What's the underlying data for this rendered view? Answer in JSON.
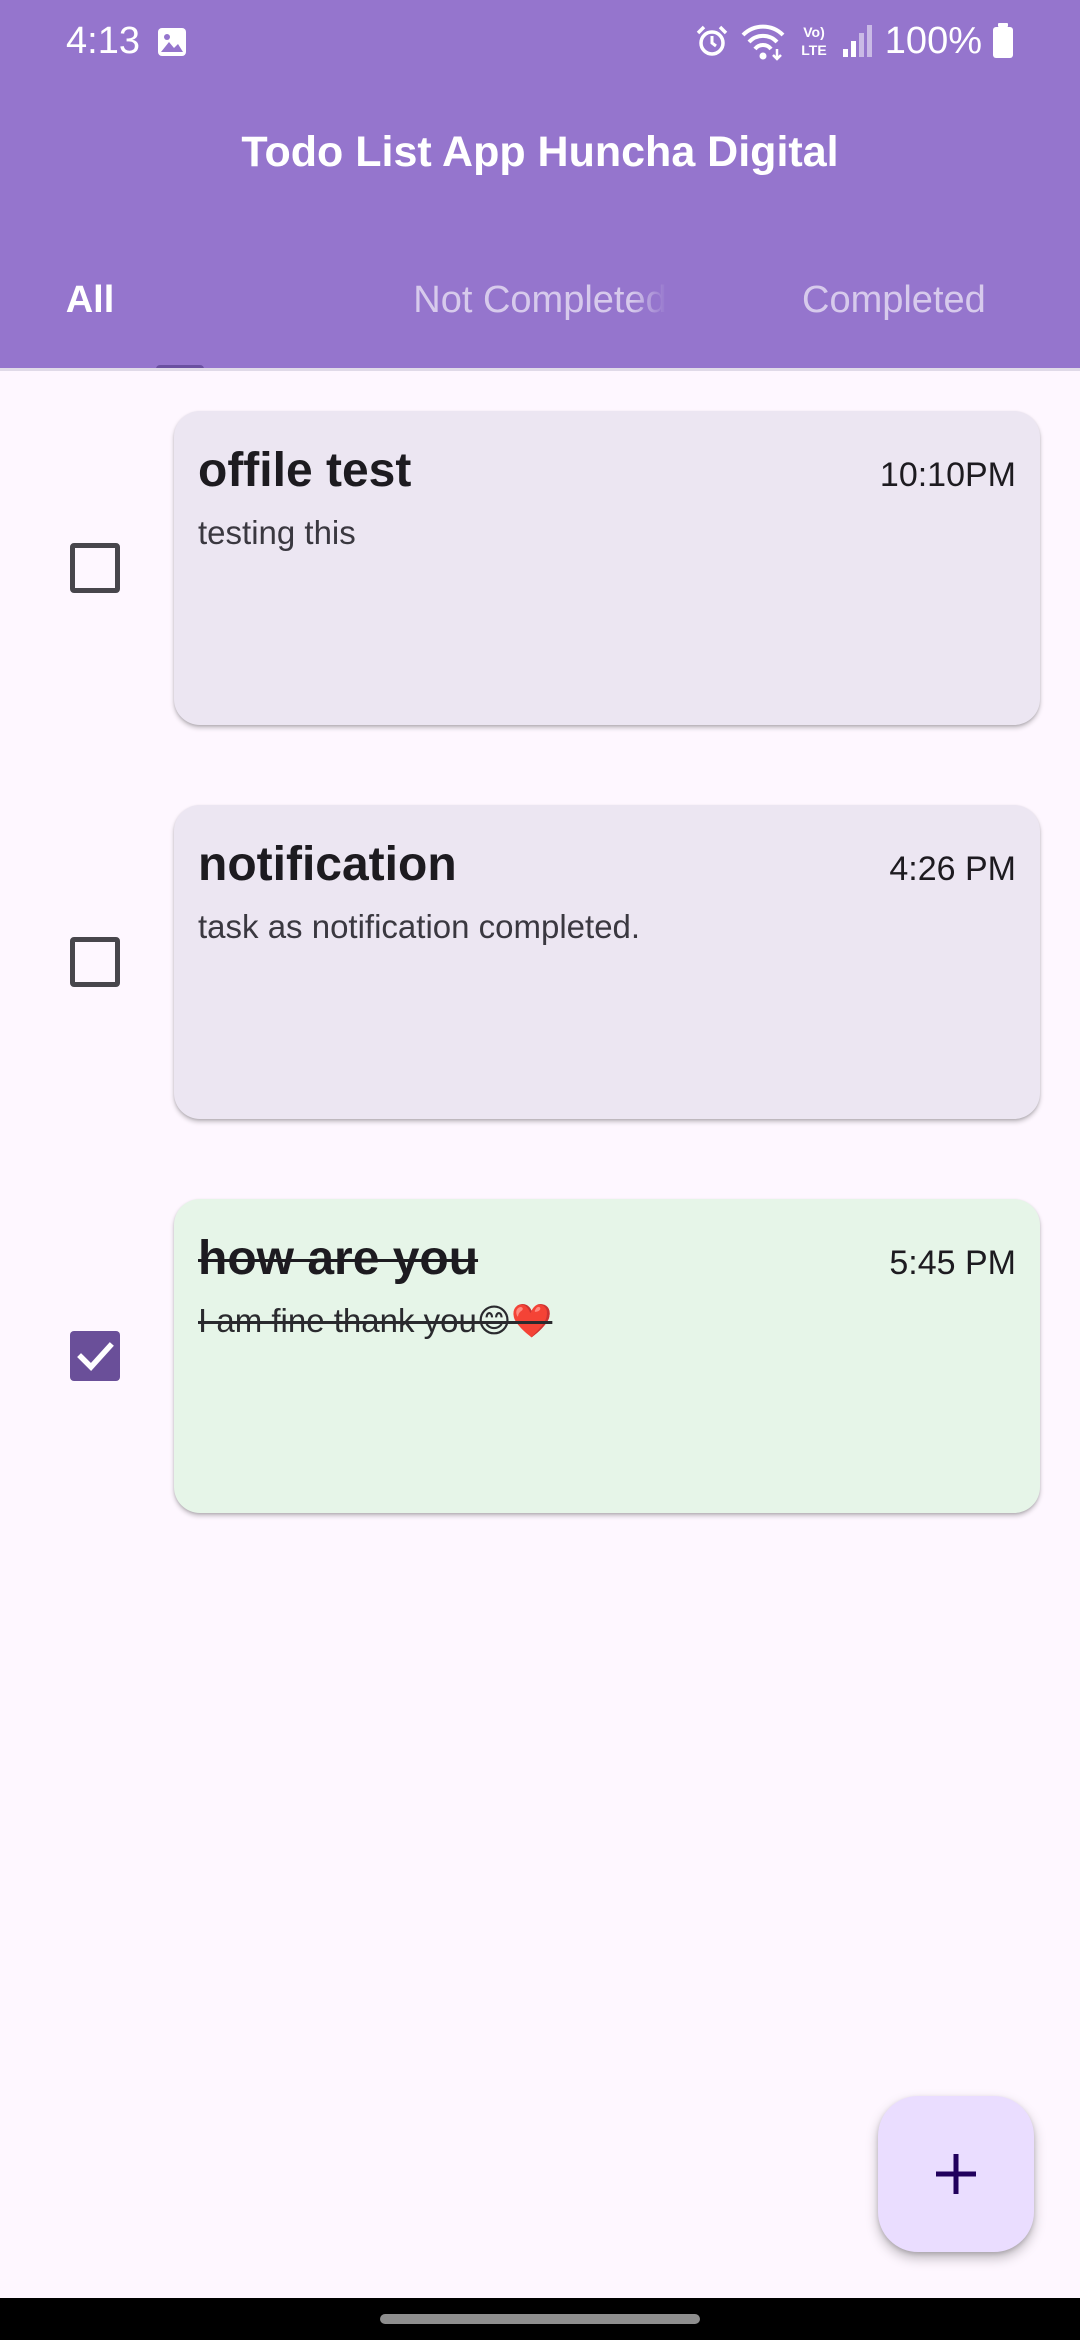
{
  "status_bar": {
    "time": "4:13",
    "battery": "100%",
    "icons": [
      "gallery-icon",
      "alarm-icon",
      "wifi-icon",
      "volte-icon",
      "signal-icon",
      "battery-icon"
    ]
  },
  "app_bar": {
    "title": "Todo List App Huncha Digital",
    "background": "#9575CD"
  },
  "tabs": [
    {
      "label": "All",
      "selected": true
    },
    {
      "label": "Not Completed",
      "selected": false
    },
    {
      "label": "Completed",
      "selected": false
    }
  ],
  "tasks": [
    {
      "title": "offile test",
      "description": "testing this",
      "time": "10:10PM",
      "completed": false
    },
    {
      "title": "notification",
      "description": "task as notification completed.",
      "time": "4:26 PM",
      "completed": false
    },
    {
      "title": "how are you",
      "description": "I am fine thank you😊❤️",
      "time": "5:45 PM",
      "completed": true
    }
  ],
  "fab": {
    "icon": "plus-icon"
  },
  "colors": {
    "accent": "#6A4F99",
    "card_pending": "#ECE6F2",
    "card_completed": "#E6F5E8",
    "fab": "#EADDFF"
  }
}
